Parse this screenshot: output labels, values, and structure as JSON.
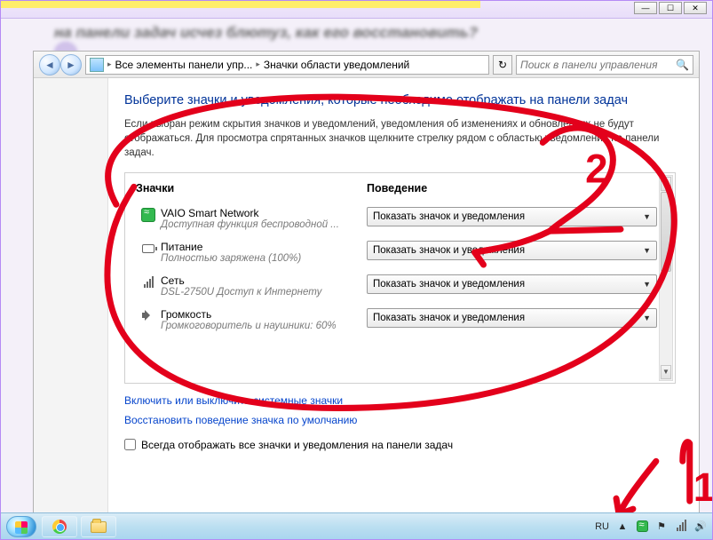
{
  "window": {
    "title_blur": "на панели задач исчез блютуз, как его восстановить?"
  },
  "nav": {
    "crumb1": "Все элементы панели упр...",
    "crumb2": "Значки области уведомлений",
    "search_placeholder": "Поиск в панели управления"
  },
  "page": {
    "title": "Выберите значки и уведомления, которые необходимо отображать на панели задач",
    "desc": "Если выбран режим скрытия значков и уведомлений, уведомления об изменениях и обновлениях не будут отображаться. Для просмотра спрятанных значков щелкните стрелку рядом с областью уведомлений на панели задач."
  },
  "columns": {
    "icon": "Значки",
    "behavior": "Поведение"
  },
  "rows": [
    {
      "name": "VAIO Smart Network",
      "sub": "Доступная функция беспроводной ...",
      "value": "Показать значок и уведомления",
      "icon": "vaio"
    },
    {
      "name": "Питание",
      "sub": "Полностью заряжена (100%)",
      "value": "Показать значок и уведомления",
      "icon": "power"
    },
    {
      "name": "Сеть",
      "sub": "DSL-2750U Доступ к Интернету",
      "value": "Показать значок и уведомления",
      "icon": "net"
    },
    {
      "name": "Громкость",
      "sub": "Громкоговоритель и наушники: 60%",
      "value": "Показать значок и уведомления",
      "icon": "vol"
    }
  ],
  "links": {
    "toggle_system": "Включить или выключить системные значки",
    "restore_default": "Восстановить поведение значка по умолчанию"
  },
  "checkbox": {
    "label": "Всегда отображать все значки и уведомления на панели задач"
  },
  "tray": {
    "lang": "RU"
  },
  "annotation": {
    "num1": "1",
    "num2": "2"
  }
}
